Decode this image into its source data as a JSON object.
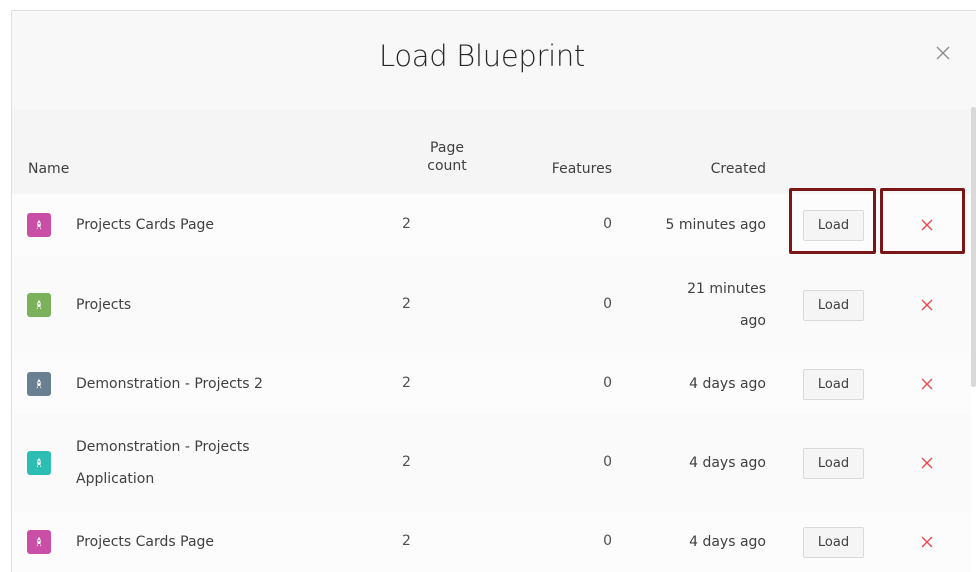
{
  "dialog": {
    "title": "Load Blueprint",
    "close_icon": "close-icon"
  },
  "table": {
    "headers": {
      "name": "Name",
      "page_count_line1": "Page",
      "page_count_line2": "count",
      "features": "Features",
      "created": "Created"
    },
    "rows": [
      {
        "name_line1": "Projects Cards Page",
        "name_line2": "",
        "page_count": "2",
        "features": "0",
        "created_line1": "5 minutes ago",
        "created_line2": "",
        "icon": "app-icon",
        "icon_color": "#c94fa6",
        "load_label": "Load",
        "delete_icon": "delete-icon"
      },
      {
        "name_line1": "Projects",
        "name_line2": "",
        "page_count": "2",
        "features": "0",
        "created_line1": "21 minutes",
        "created_line2": "ago",
        "icon": "app-icon",
        "icon_color": "#7bb15a",
        "load_label": "Load",
        "delete_icon": "delete-icon"
      },
      {
        "name_line1": "Demonstration - Projects 2",
        "name_line2": "",
        "page_count": "2",
        "features": "0",
        "created_line1": "4 days ago",
        "created_line2": "",
        "icon": "app-icon",
        "icon_color": "#6b7f92",
        "load_label": "Load",
        "delete_icon": "delete-icon"
      },
      {
        "name_line1": "Demonstration - Projects",
        "name_line2": "Application",
        "page_count": "2",
        "features": "0",
        "created_line1": "4 days ago",
        "created_line2": "",
        "icon": "app-icon",
        "icon_color": "#2ebdb3",
        "load_label": "Load",
        "delete_icon": "delete-icon"
      },
      {
        "name_line1": "Projects Cards Page",
        "name_line2": "",
        "page_count": "2",
        "features": "0",
        "created_line1": "4 days ago",
        "created_line2": "",
        "icon": "app-icon",
        "icon_color": "#c94fa6",
        "load_label": "Load",
        "delete_icon": "delete-icon"
      }
    ]
  },
  "colors": {
    "highlight": "#7a1616",
    "delete": "#e8484f"
  }
}
